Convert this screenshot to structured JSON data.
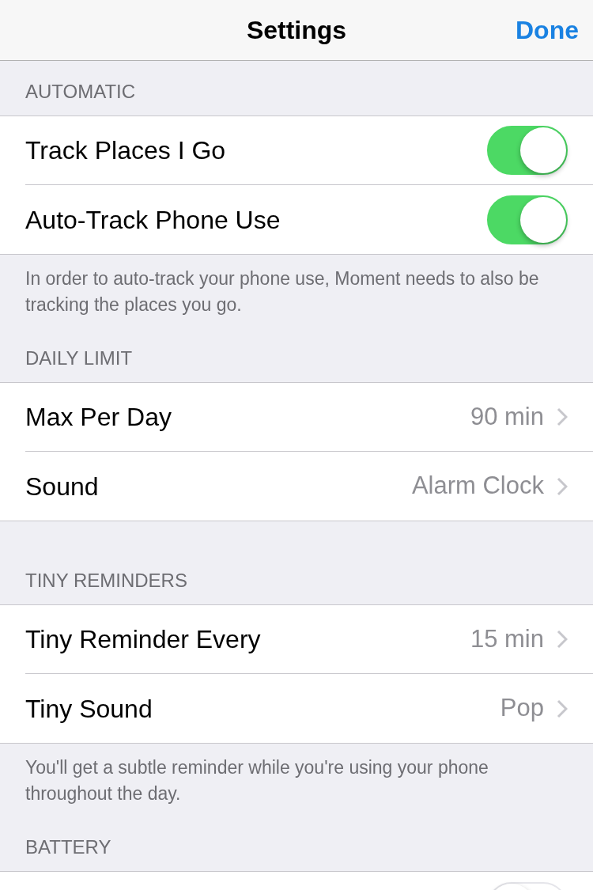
{
  "nav": {
    "title": "Settings",
    "done": "Done"
  },
  "sections": [
    {
      "header": "AUTOMATIC",
      "rows": [
        {
          "kind": "toggle",
          "label": "Track Places I Go",
          "on": true
        },
        {
          "kind": "toggle",
          "label": "Auto-Track Phone Use",
          "on": true
        }
      ],
      "footer": "In order to auto-track your phone use, Moment needs to also be tracking the places you go."
    },
    {
      "header": "DAILY LIMIT",
      "rows": [
        {
          "kind": "link",
          "label": "Max Per Day",
          "value": "90 min"
        },
        {
          "kind": "link",
          "label": "Sound",
          "value": "Alarm Clock"
        }
      ]
    },
    {
      "header": "TINY REMINDERS",
      "rows": [
        {
          "kind": "link",
          "label": "Tiny Reminder Every",
          "value": "15 min"
        },
        {
          "kind": "link",
          "label": "Tiny Sound",
          "value": "Pop"
        }
      ],
      "footer": "You'll get a subtle reminder while you're using your phone throughout the day."
    },
    {
      "header": "BATTERY",
      "rows": [
        {
          "kind": "toggle",
          "on": false
        }
      ]
    }
  ]
}
